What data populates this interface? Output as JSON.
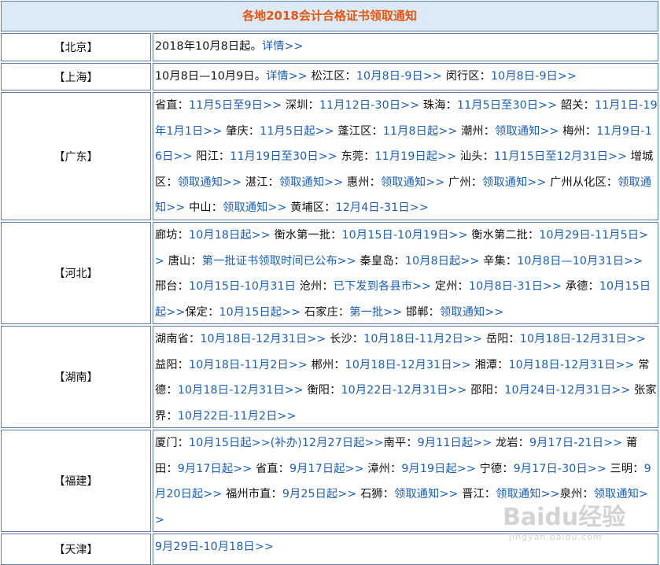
{
  "title": "各地2018会计合格证书领取通知",
  "rows": [
    {
      "region": "【北京】",
      "height": 36,
      "segments": [
        {
          "t": "2018年10月8日起。",
          "l": false
        },
        {
          "t": "详情>>",
          "l": true
        }
      ]
    },
    {
      "region": "【上海】",
      "height": 35,
      "segments": [
        {
          "t": "10月8日—10月9日。",
          "l": false
        },
        {
          "t": "详情>>",
          "l": true
        },
        {
          "t": " 松江区：",
          "l": false
        },
        {
          "t": "10月8日-9日>>",
          "l": true
        },
        {
          "t": " 闵行区：",
          "l": false
        },
        {
          "t": "10月8日-9日>>",
          "l": true
        }
      ]
    },
    {
      "region": "【广东】",
      "height": 163,
      "segments": [
        {
          "t": "省直：",
          "l": false
        },
        {
          "t": "11月5日至9日>>",
          "l": true
        },
        {
          "t": " 深圳：",
          "l": false
        },
        {
          "t": "11月12日-30日>>",
          "l": true
        },
        {
          "t": " 珠海：",
          "l": false
        },
        {
          "t": "11月5日至30日>>",
          "l": true
        },
        {
          "t": " 韶关：",
          "l": false
        },
        {
          "t": "11月1日-19年1月1日>>",
          "l": true
        },
        {
          "t": " 肇庆：",
          "l": false
        },
        {
          "t": "11月5日起>>",
          "l": true
        },
        {
          "t": " 蓬江区：",
          "l": false
        },
        {
          "t": "11月8日起>>",
          "l": true
        },
        {
          "t": " 潮州：",
          "l": false
        },
        {
          "t": "领取通知>>",
          "l": true
        },
        {
          "t": " 梅州：",
          "l": false
        },
        {
          "t": "11月9日-16日>>",
          "l": true
        },
        {
          "t": " 阳江：",
          "l": false
        },
        {
          "t": "11月19日至30日>>",
          "l": true
        },
        {
          "t": " 东莞：",
          "l": false
        },
        {
          "t": "11月19日起>>",
          "l": true
        },
        {
          "t": " 汕头：",
          "l": false
        },
        {
          "t": "11月15日至12月31日>>",
          "l": true
        },
        {
          "t": " 增城区：",
          "l": false
        },
        {
          "t": "领取通知>>",
          "l": true
        },
        {
          "t": " 湛江：",
          "l": false
        },
        {
          "t": "领取通知>>",
          "l": true
        },
        {
          "t": " 惠州：",
          "l": false
        },
        {
          "t": "领取通知>>",
          "l": true
        },
        {
          "t": " 广州：",
          "l": false
        },
        {
          "t": "领取通知>>",
          "l": true
        },
        {
          "t": "  广州从化区：",
          "l": false
        },
        {
          "t": "领取通知>>",
          "l": true
        },
        {
          "t": " 中山：",
          "l": false
        },
        {
          "t": "领取通知>>",
          "l": true
        },
        {
          "t": " 黄埔区：",
          "l": false
        },
        {
          "t": "12月4日-31日>>",
          "l": true
        }
      ]
    },
    {
      "region": "【河北】",
      "height": 130,
      "segments": [
        {
          "t": "廊坊：",
          "l": false
        },
        {
          "t": "10月18日起>>",
          "l": true
        },
        {
          "t": " 衡水第一批：",
          "l": false
        },
        {
          "t": "10月15日-10月19日>>",
          "l": true
        },
        {
          "t": " 衡水第二批：",
          "l": false
        },
        {
          "t": "10月29日-11月5日>>",
          "l": true
        },
        {
          "t": " 唐山：",
          "l": false
        },
        {
          "t": "第一批证书领取时间已公布>>",
          "l": true
        },
        {
          "t": " 秦皇岛：",
          "l": false
        },
        {
          "t": "10月8日起>>",
          "l": true
        },
        {
          "t": " 辛集：",
          "l": false
        },
        {
          "t": "10月8日—10月31日>>",
          "l": true
        },
        {
          "t": " 邢台：",
          "l": false
        },
        {
          "t": "10月15日-10月31日",
          "l": true
        },
        {
          "t": " 沧州：",
          "l": false
        },
        {
          "t": "已下发到各县市>>",
          "l": true
        },
        {
          "t": " 定州：",
          "l": false
        },
        {
          "t": "10月8日-31日>>",
          "l": true
        },
        {
          "t": " 承德：",
          "l": false
        },
        {
          "t": "10月15日起>>",
          "l": true
        },
        {
          "t": "保定：",
          "l": false
        },
        {
          "t": "10月15日起>>",
          "l": true
        },
        {
          "t": " 石家庄：",
          "l": false
        },
        {
          "t": "第一批>>",
          "l": true
        },
        {
          "t": " 邯郸：",
          "l": false
        },
        {
          "t": "领取通知>>",
          "l": true
        }
      ]
    },
    {
      "region": "【湖南】",
      "height": 130,
      "segments": [
        {
          "t": "湖南省：",
          "l": false
        },
        {
          "t": "10月18日-12月31日>>",
          "l": true
        },
        {
          "t": " 长沙：",
          "l": false
        },
        {
          "t": "10月18日-11月2日>>",
          "l": true
        },
        {
          "t": " 岳阳：",
          "l": false
        },
        {
          "t": "10月18日-12月31日>>",
          "l": true
        },
        {
          "t": " 益阳：",
          "l": false
        },
        {
          "t": "10月18日-11月2日>>",
          "l": true
        },
        {
          "t": " 郴州：",
          "l": false
        },
        {
          "t": "10月18日-12月31日>>",
          "l": true
        },
        {
          "t": " 湘潭：",
          "l": false
        },
        {
          "t": "10月18日-12月31日>>",
          "l": true
        },
        {
          "t": " 常德：",
          "l": false
        },
        {
          "t": "10月18日-12月31日>>",
          "l": true
        },
        {
          "t": " 衡阳：",
          "l": false
        },
        {
          "t": "10月22日-12月31日>>",
          "l": true
        },
        {
          "t": "  邵阳：",
          "l": false
        },
        {
          "t": "10月24日-12月31日>>",
          "l": true
        },
        {
          "t": " 张家界：",
          "l": false
        },
        {
          "t": "10月22日-11月2日>>",
          "l": true
        }
      ]
    },
    {
      "region": "【福建】",
      "height": 130,
      "segments": [
        {
          "t": "厦门：",
          "l": false
        },
        {
          "t": "10月15日起>>(补办)12月27日起>>",
          "l": true
        },
        {
          "t": "南平：",
          "l": false
        },
        {
          "t": "9月11日起>>",
          "l": true
        },
        {
          "t": " 龙岩：",
          "l": false
        },
        {
          "t": "9月17日-21日>>",
          "l": true
        },
        {
          "t": " 莆田：",
          "l": false
        },
        {
          "t": "9月17日起>>",
          "l": true
        },
        {
          "t": " 省直：",
          "l": false
        },
        {
          "t": "9月17日起>>",
          "l": true
        },
        {
          "t": " 漳州：",
          "l": false
        },
        {
          "t": "9月19日起>>",
          "l": true
        },
        {
          "t": " 宁德：",
          "l": false
        },
        {
          "t": "9月17日-30日>>",
          "l": true
        },
        {
          "t": " 三明：",
          "l": false
        },
        {
          "t": "9月20日起>>",
          "l": true
        },
        {
          "t": " 福州市直：",
          "l": false
        },
        {
          "t": "9月25日起>>",
          "l": true
        },
        {
          "t": " 石狮：",
          "l": false
        },
        {
          "t": "领取通知>>",
          "l": true
        },
        {
          "t": " 晋江：",
          "l": false
        },
        {
          "t": "领取通知>>",
          "l": true
        },
        {
          "t": "泉州：",
          "l": false
        },
        {
          "t": "领取通知>>",
          "l": true
        }
      ]
    },
    {
      "region": "【天津】",
      "height": 40,
      "segments": [
        {
          "t": "9月29日-10月18日>>",
          "l": true
        }
      ]
    }
  ],
  "watermark": {
    "brand": "Baidu经验",
    "sub": "jingyan.baidu.com"
  }
}
